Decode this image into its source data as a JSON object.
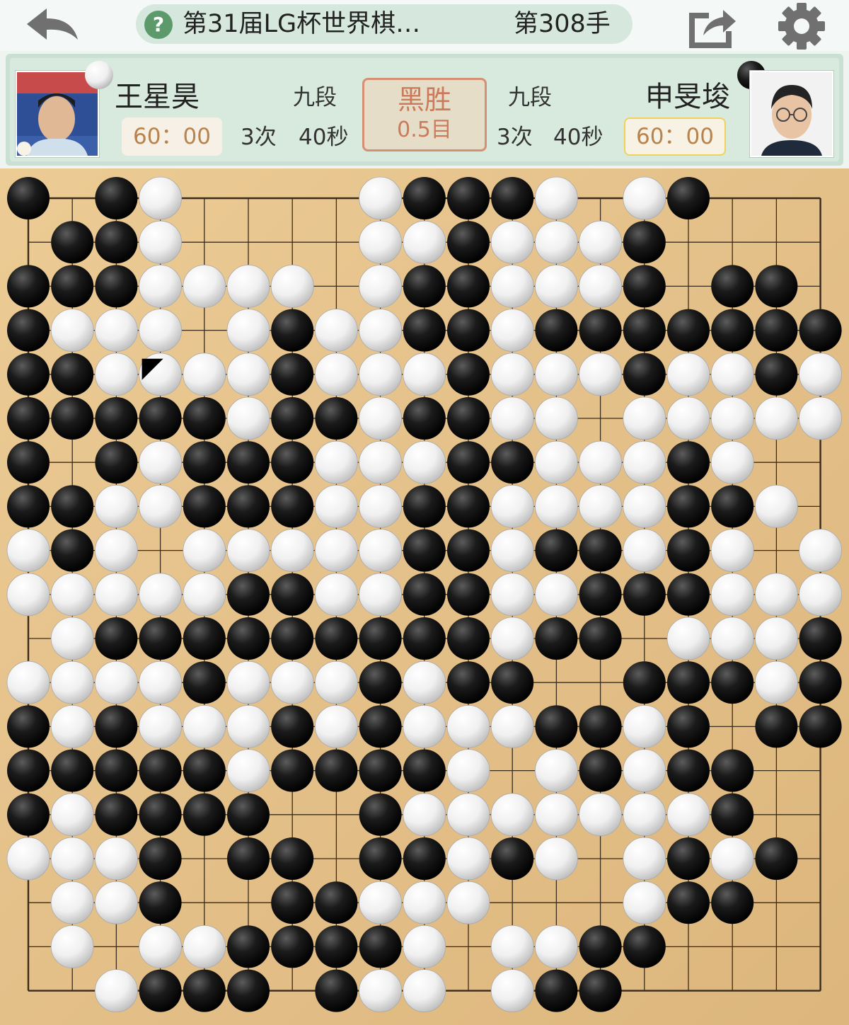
{
  "header": {
    "title": "第31届LG杯世界棋…",
    "move_label": "第308手",
    "help_icon": "question-circle-icon",
    "back_icon": "back-arrow-icon",
    "share_icon": "share-icon",
    "settings_icon": "gear-icon"
  },
  "players": {
    "white": {
      "name": "王星昊",
      "rank": "九段",
      "clock": "60：00",
      "byo_yomi_count": "3次",
      "byo_yomi_time": "40秒"
    },
    "black": {
      "name": "申旻埈",
      "rank": "九段",
      "clock": "60：00",
      "byo_yomi_count": "3次",
      "byo_yomi_time": "40秒"
    }
  },
  "result": {
    "winner": "黑胜",
    "margin": "0.5目"
  },
  "colors": {
    "accent_green": "#5c9a6c",
    "result_red": "#cc7a5a",
    "clock_text": "#b8834c",
    "board_wood": "#e4c089"
  },
  "board": {
    "size": 19,
    "last_move": [
      3,
      4
    ],
    "rows": [
      "B.BW....WBBBW.WB...",
      ".BBW....WWBWWWB....",
      "BBBWWWW.WBBWWWB.BB.",
      "BWWW.WBWWBBWBBBBBBB",
      "BBWWWWBWWWBWWWBWWBW",
      "BBBBBWBBWBBWW.WWWWW",
      "B.BWBBBWWWBBWWWBW..",
      "BBWWBBBWWBBWWWWBBW.",
      "WBW.WWWWWBBWBBWBW.W",
      "WWWWWBBWWBBWWBBBWWW",
      ".WBBBBBBBBBWBB.WWWB",
      "WWWWBWWWBWBB..BBBWB",
      "BWBWWWBWBWWWBBWB.BB",
      "BBBBBWBBBBW.WBWBB..",
      "BWBBBB..BWWWWWWWB..",
      "WWWB.BB.BBWBW.WBWB.",
      ".WWB..BBWWW...WBB..",
      ".W.WWBBBBW.WWBB....",
      "..WBBB.BWW.WBB....."
    ]
  }
}
